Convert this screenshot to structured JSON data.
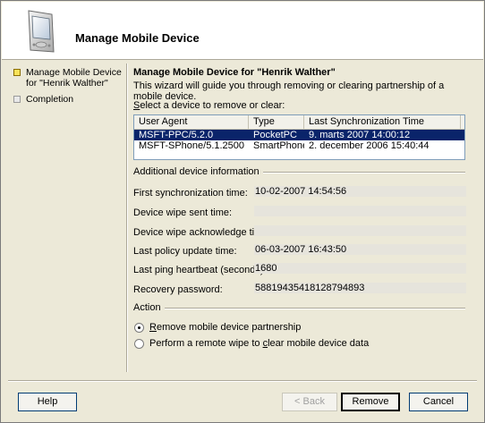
{
  "header": {
    "title": "Manage Mobile Device"
  },
  "steps": [
    {
      "label_line1": "Manage Mobile Device",
      "label_line2": "for \"Henrik Walther\"",
      "active": true
    },
    {
      "label_line1": "Completion",
      "label_line2": "",
      "active": false
    }
  ],
  "content": {
    "title": "Manage Mobile Device for \"Henrik Walther\"",
    "description": "This wizard will guide you through removing or clearing partnership of a mobile device.",
    "select_prefix": "S",
    "select_rest": "elect a device to remove or clear:"
  },
  "device_list": {
    "columns": [
      "User Agent",
      "Type",
      "Last Synchronization Time"
    ],
    "rows": [
      {
        "user_agent": "MSFT-PPC/5.2.0",
        "type": "PocketPC",
        "last_sync": "9. marts 2007 14:00:12",
        "selected": true
      },
      {
        "user_agent": "MSFT-SPhone/5.1.2500",
        "type": "SmartPhone",
        "last_sync": "2. december 2006 15:40:44",
        "selected": false
      }
    ]
  },
  "info": {
    "group_label": "Additional device information",
    "first_sync_label": "First synchronization time:",
    "first_sync_value": "10-02-2007 14:54:56",
    "wipe_sent_label": "Device wipe sent time:",
    "wipe_sent_value": "",
    "wipe_ack_label": "Device wipe acknowledge time:",
    "wipe_ack_value": "",
    "policy_update_label": "Last policy update time:",
    "policy_update_value": "06-03-2007 16:43:50",
    "ping_label": "Last ping heartbeat (seconds):",
    "ping_value": "1680",
    "recovery_label": "Recovery password:",
    "recovery_value": "58819435418128794893"
  },
  "action": {
    "group_label": "Action",
    "remove_label": "Remove mobile device partnership",
    "remove_underline": "R",
    "remove_rest": "emove mobile device partnership",
    "wipe_label_before": "Perform a remote wipe to ",
    "wipe_underline": "c",
    "wipe_label_after": "lear mobile device data",
    "selected": "remove"
  },
  "buttons": {
    "help": "Help",
    "back": "< Back",
    "remove": "Remove",
    "cancel": "Cancel"
  }
}
